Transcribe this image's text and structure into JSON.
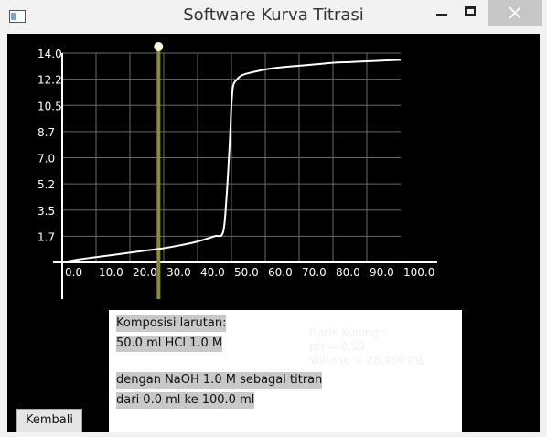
{
  "window": {
    "title": "Software Kurva Titrasi",
    "icons": [
      "app-window-icon",
      "minimize-icon",
      "maximize-icon",
      "close-icon"
    ]
  },
  "chart_data": {
    "type": "line",
    "x_ticks": [
      "0.0",
      "10.0",
      "20.0",
      "30.0",
      "40.0",
      "50.0",
      "60.0",
      "70.0",
      "80.0",
      "90.0",
      "100.0"
    ],
    "y_ticks": [
      "1.7",
      "3.5",
      "5.2",
      "7.0",
      "8.7",
      "10.5",
      "12.2",
      "14.0"
    ],
    "xlim": [
      0,
      100
    ],
    "ylim": [
      0,
      14
    ],
    "grid": true,
    "series": [
      {
        "color": "#ffffff",
        "x": [
          0,
          5,
          10,
          15,
          20,
          25,
          30,
          35,
          40,
          45,
          47.5,
          48.5,
          49.5,
          50,
          50.5,
          51.5,
          53,
          55,
          60,
          65,
          70,
          75,
          80,
          85,
          90,
          95,
          100
        ],
        "y": [
          0.0,
          0.2,
          0.35,
          0.5,
          0.65,
          0.8,
          0.95,
          1.15,
          1.4,
          1.75,
          2.0,
          4.2,
          8.0,
          10.5,
          11.8,
          12.2,
          12.5,
          12.65,
          12.9,
          13.05,
          13.15,
          13.25,
          13.35,
          13.4,
          13.45,
          13.5,
          13.55
        ]
      }
    ],
    "marker": {
      "color": "#8b8b2a",
      "volume": 28.459,
      "ph": 0.59
    }
  },
  "info": {
    "line1": "Komposisi larutan:",
    "line2": "50.0 ml HCl 1.0 M",
    "line3": "dengan NaOH 1.0 M sebagai titran",
    "line4": "dari 0.0 ml ke 100.0 ml",
    "cursor_title": "Garis Kuning :",
    "cursor_ph": "pH = 0.59",
    "cursor_volume": "Volume = 28.459 mL"
  },
  "buttons": {
    "back_label": "Kembali"
  }
}
